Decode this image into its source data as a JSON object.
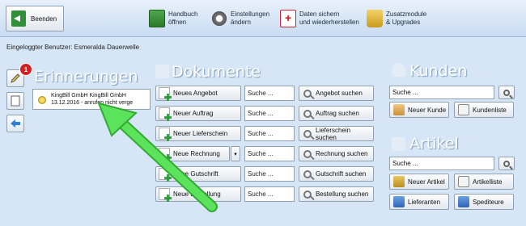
{
  "toolbar": {
    "exit_label": "Beenden",
    "items": [
      {
        "line1": "Handbuch",
        "line2": "öffnen",
        "icon": "manual-book-icon"
      },
      {
        "line1": "Einstellungen",
        "line2": "ändern",
        "icon": "gear-icon"
      },
      {
        "line1": "Daten sichern",
        "line2": "und wiederherstellen",
        "icon": "backup-icon"
      },
      {
        "line1": "Zusatzmodule",
        "line2": "& Upgrades",
        "icon": "lock-icon"
      }
    ]
  },
  "user_line": "Eingeloggter Benutzer: Esmeralda Dauerwelle",
  "sidebar": {
    "badge": "1"
  },
  "reminders": {
    "title": "Erinnerungen",
    "item_line1": "KingBill GmbH KingBill GmbH",
    "item_line2": "13.12.2016 - anrufen nicht verge"
  },
  "documents": {
    "title": "Dokumente",
    "rows": [
      {
        "new_label": "Neues Angebot",
        "search_placeholder": "Suche ...",
        "search_label": "Angebot suchen"
      },
      {
        "new_label": "Neuer Auftrag",
        "search_placeholder": "Suche ...",
        "search_label": "Auftrag suchen"
      },
      {
        "new_label": "Neuer Lieferschein",
        "search_placeholder": "Suche ...",
        "search_label": "Lieferschein suchen"
      },
      {
        "new_label": "Neue Rechnung",
        "search_placeholder": "Suche ...",
        "search_label": "Rechnung suchen"
      },
      {
        "new_label": "Neue Gutschrift",
        "search_placeholder": "Suche ...",
        "search_label": "Gutschrift suchen"
      },
      {
        "new_label": "Neue Bestellung",
        "search_placeholder": "Suche ...",
        "search_label": "Bestellung suchen"
      }
    ]
  },
  "customers": {
    "title": "Kunden",
    "search_placeholder": "Suche ...",
    "new_label": "Neuer Kunde",
    "list_label": "Kundenliste"
  },
  "articles": {
    "title": "Artikel",
    "search_placeholder": "Suche ...",
    "new_label": "Neuer Artikel",
    "list_label": "Artikelliste",
    "suppliers_label": "Lieferanten",
    "carriers_label": "Spediteure"
  }
}
